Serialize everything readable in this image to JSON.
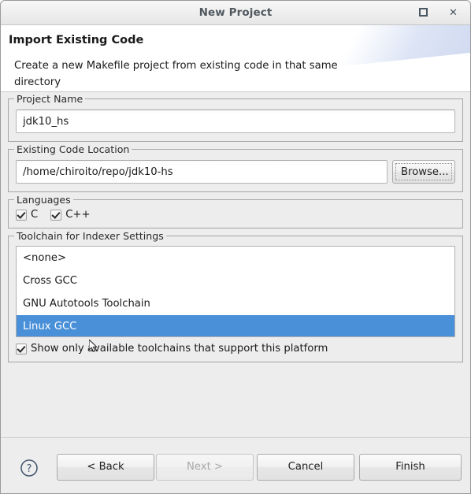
{
  "window": {
    "title": "New Project",
    "controls": {
      "maximize_label": "maximize",
      "close_label": "✕"
    }
  },
  "header": {
    "title": "Import Existing Code",
    "description": "Create a new Makefile project from existing code in that same directory"
  },
  "project_name": {
    "group_label": "Project Name",
    "value": "jdk10_hs",
    "placeholder": ""
  },
  "existing_code_location": {
    "group_label": "Existing Code Location",
    "value": "/home/chiroito/repo/jdk10-hs",
    "placeholder": "",
    "browse_label": "Browse..."
  },
  "languages": {
    "group_label": "Languages",
    "options": [
      {
        "label": "C",
        "checked": true
      },
      {
        "label": "C++",
        "checked": true
      }
    ]
  },
  "toolchain": {
    "group_label": "Toolchain for Indexer Settings",
    "items": [
      {
        "label": "<none>",
        "selected": false
      },
      {
        "label": "Cross GCC",
        "selected": false
      },
      {
        "label": "GNU Autotools Toolchain",
        "selected": false
      },
      {
        "label": "Linux GCC",
        "selected": true
      }
    ],
    "filter_checkbox": {
      "label": "Show only available toolchains that support this platform",
      "checked": true
    }
  },
  "footer": {
    "help_label": "?",
    "back_label": "< Back",
    "next_label": "Next >",
    "next_enabled": false,
    "cancel_label": "Cancel",
    "finish_label": "Finish"
  },
  "colors": {
    "selection_blue": "#4a90d9",
    "window_bg": "#ededed",
    "header_bg": "#ffffff",
    "title_text": "#50585f",
    "help_icon": "#4a5a73"
  }
}
